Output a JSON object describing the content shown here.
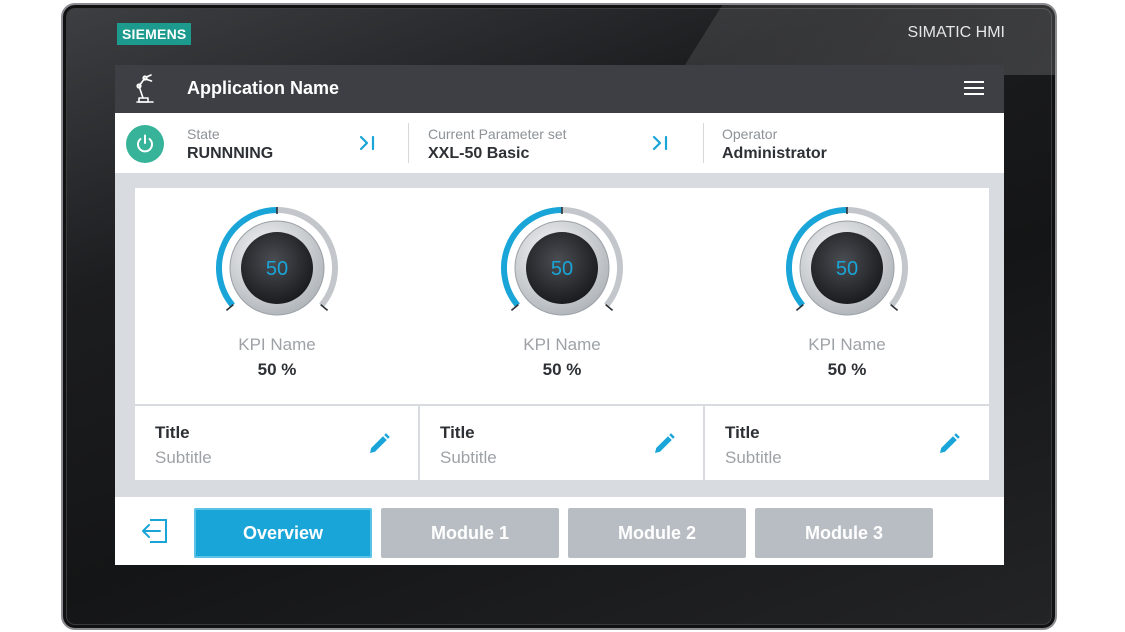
{
  "device": {
    "brand": "SIEMENS",
    "model": "SIMATIC HMI"
  },
  "header": {
    "app_icon": "robot-arm-icon",
    "title": "Application Name",
    "menu_icon": "hamburger-menu-icon"
  },
  "status": {
    "power_icon": "power-icon",
    "state_label": "State",
    "state_value": "RUNNNING",
    "param_label": "Current Parameter set",
    "param_value": "XXL-50 Basic",
    "operator_label": "Operator",
    "operator_value": "Administrator",
    "skip_icon": "skip-forward-icon"
  },
  "kpis": [
    {
      "gauge_value": "50",
      "fraction": 0.5,
      "name": "KPI Name",
      "value": "50 %"
    },
    {
      "gauge_value": "50",
      "fraction": 0.5,
      "name": "KPI Name",
      "value": "50 %"
    },
    {
      "gauge_value": "50",
      "fraction": 0.5,
      "name": "KPI Name",
      "value": "50 %"
    }
  ],
  "tiles": [
    {
      "title": "Title",
      "subtitle": "Subtitle",
      "icon": "pencil-edit-icon"
    },
    {
      "title": "Title",
      "subtitle": "Subtitle",
      "icon": "pencil-edit-icon"
    },
    {
      "title": "Title",
      "subtitle": "Subtitle",
      "icon": "pencil-edit-icon"
    }
  ],
  "nav": {
    "logout_icon": "logout-icon",
    "buttons": [
      {
        "label": "Overview",
        "active": true
      },
      {
        "label": "Module 1",
        "active": false
      },
      {
        "label": "Module 2",
        "active": false
      },
      {
        "label": "Module 3",
        "active": false
      }
    ]
  },
  "colors": {
    "accent": "#1aa5d8",
    "power": "#37b39a",
    "brand": "#1d9a8e",
    "header": "#3d3f44",
    "inactive_button": "#b8bdc3"
  }
}
